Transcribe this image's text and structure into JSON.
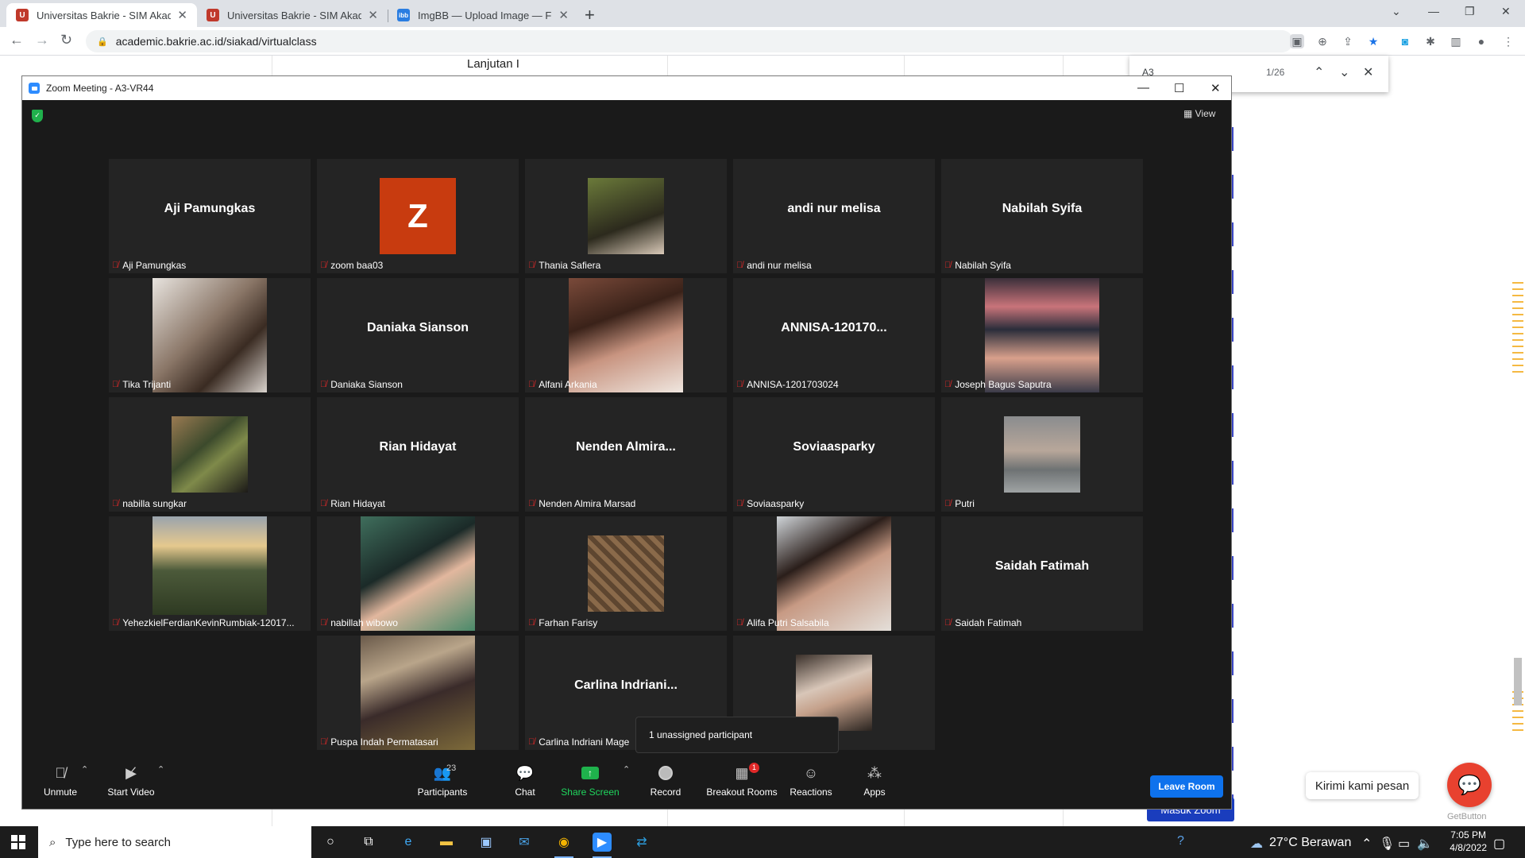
{
  "browser": {
    "tabs": [
      {
        "title": "Universitas Bakrie - SIM Akadem",
        "favicon": "ub"
      },
      {
        "title": "Universitas Bakrie - SIM Akadem",
        "favicon": "ub"
      },
      {
        "title": "ImgBB — Upload Image — Free",
        "favicon": "ibb"
      }
    ],
    "url": "academic.bakrie.ac.id/siakad/virtualclass",
    "find": {
      "query": "A3",
      "count": "1/26"
    }
  },
  "page": {
    "lanjutan": "Lanjutan I",
    "chat_bubble": "Kirimi kami pesan",
    "getbutton": "GetButton",
    "masuk_zoom": "Masuk Zoom"
  },
  "zoom": {
    "window_title": "Zoom Meeting - A3-VR44",
    "view_label": "View",
    "avatar_letter": "Z",
    "participants": [
      {
        "name": "Aji Pamungkas",
        "big": "Aji Pamungkas",
        "video": false
      },
      {
        "name": "zoom baa03",
        "big": "",
        "video": false,
        "avatar": true
      },
      {
        "name": "Thania Safiera",
        "big": "",
        "video": true
      },
      {
        "name": "andi nur melisa",
        "big": "andi nur melisa",
        "video": false
      },
      {
        "name": "Nabilah Syifa",
        "big": "Nabilah Syifa",
        "video": false
      },
      {
        "name": "Tika Trijanti",
        "big": "",
        "video": true
      },
      {
        "name": "Daniaka Sianson",
        "big": "Daniaka Sianson",
        "video": false
      },
      {
        "name": "Alfani Arkania",
        "big": "",
        "video": true
      },
      {
        "name": "ANNISA-1201703024",
        "big": "ANNISA-120170...",
        "video": false
      },
      {
        "name": "Joseph Bagus Saputra",
        "big": "",
        "video": true
      },
      {
        "name": "nabilla sungkar",
        "big": "",
        "video": true
      },
      {
        "name": "Rian Hidayat",
        "big": "Rian Hidayat",
        "video": false
      },
      {
        "name": "Nenden Almira Marsad",
        "big": "Nenden  Almira...",
        "video": false
      },
      {
        "name": "Soviaasparky",
        "big": "Soviaasparky",
        "video": false
      },
      {
        "name": "Putri",
        "big": "",
        "video": true
      },
      {
        "name": "YehezkielFerdianKevinRumbiak-12017...",
        "big": "",
        "video": true
      },
      {
        "name": "nabillah wibowo",
        "big": "",
        "video": true
      },
      {
        "name": "Farhan Farisy",
        "big": "",
        "video": true
      },
      {
        "name": "Alifa Putri Salsabila",
        "big": "",
        "video": true
      },
      {
        "name": "Saidah Fatimah",
        "big": "Saidah Fatimah",
        "video": false
      },
      {
        "name": "Puspa Indah Permatasari",
        "big": "",
        "video": true
      },
      {
        "name": "Carlina Indriani Mage",
        "big": "Carlina  Indriani...",
        "video": false
      },
      {
        "name": "",
        "big": "",
        "video": true
      }
    ],
    "popup": "1 unassigned participant",
    "controls": {
      "unmute": "Unmute",
      "start_video": "Start Video",
      "participants": "Participants",
      "participant_count": "23",
      "chat": "Chat",
      "share_screen": "Share Screen",
      "record": "Record",
      "breakout_rooms": "Breakout Rooms",
      "breakout_badge": "1",
      "reactions": "Reactions",
      "apps": "Apps",
      "leave_room": "Leave Room"
    }
  },
  "taskbar": {
    "search_placeholder": "Type here to search",
    "weather": "27°C  Berawan",
    "time": "7:05 PM",
    "date": "4/8/2022"
  },
  "colors": {
    "zoom_bg": "#1a1a1a",
    "tile_bg": "#242424",
    "share_green": "#1fd65d",
    "leave_blue": "#0e72ed",
    "avatar_orange": "#c83b0f",
    "muted_red": "#e02828"
  }
}
